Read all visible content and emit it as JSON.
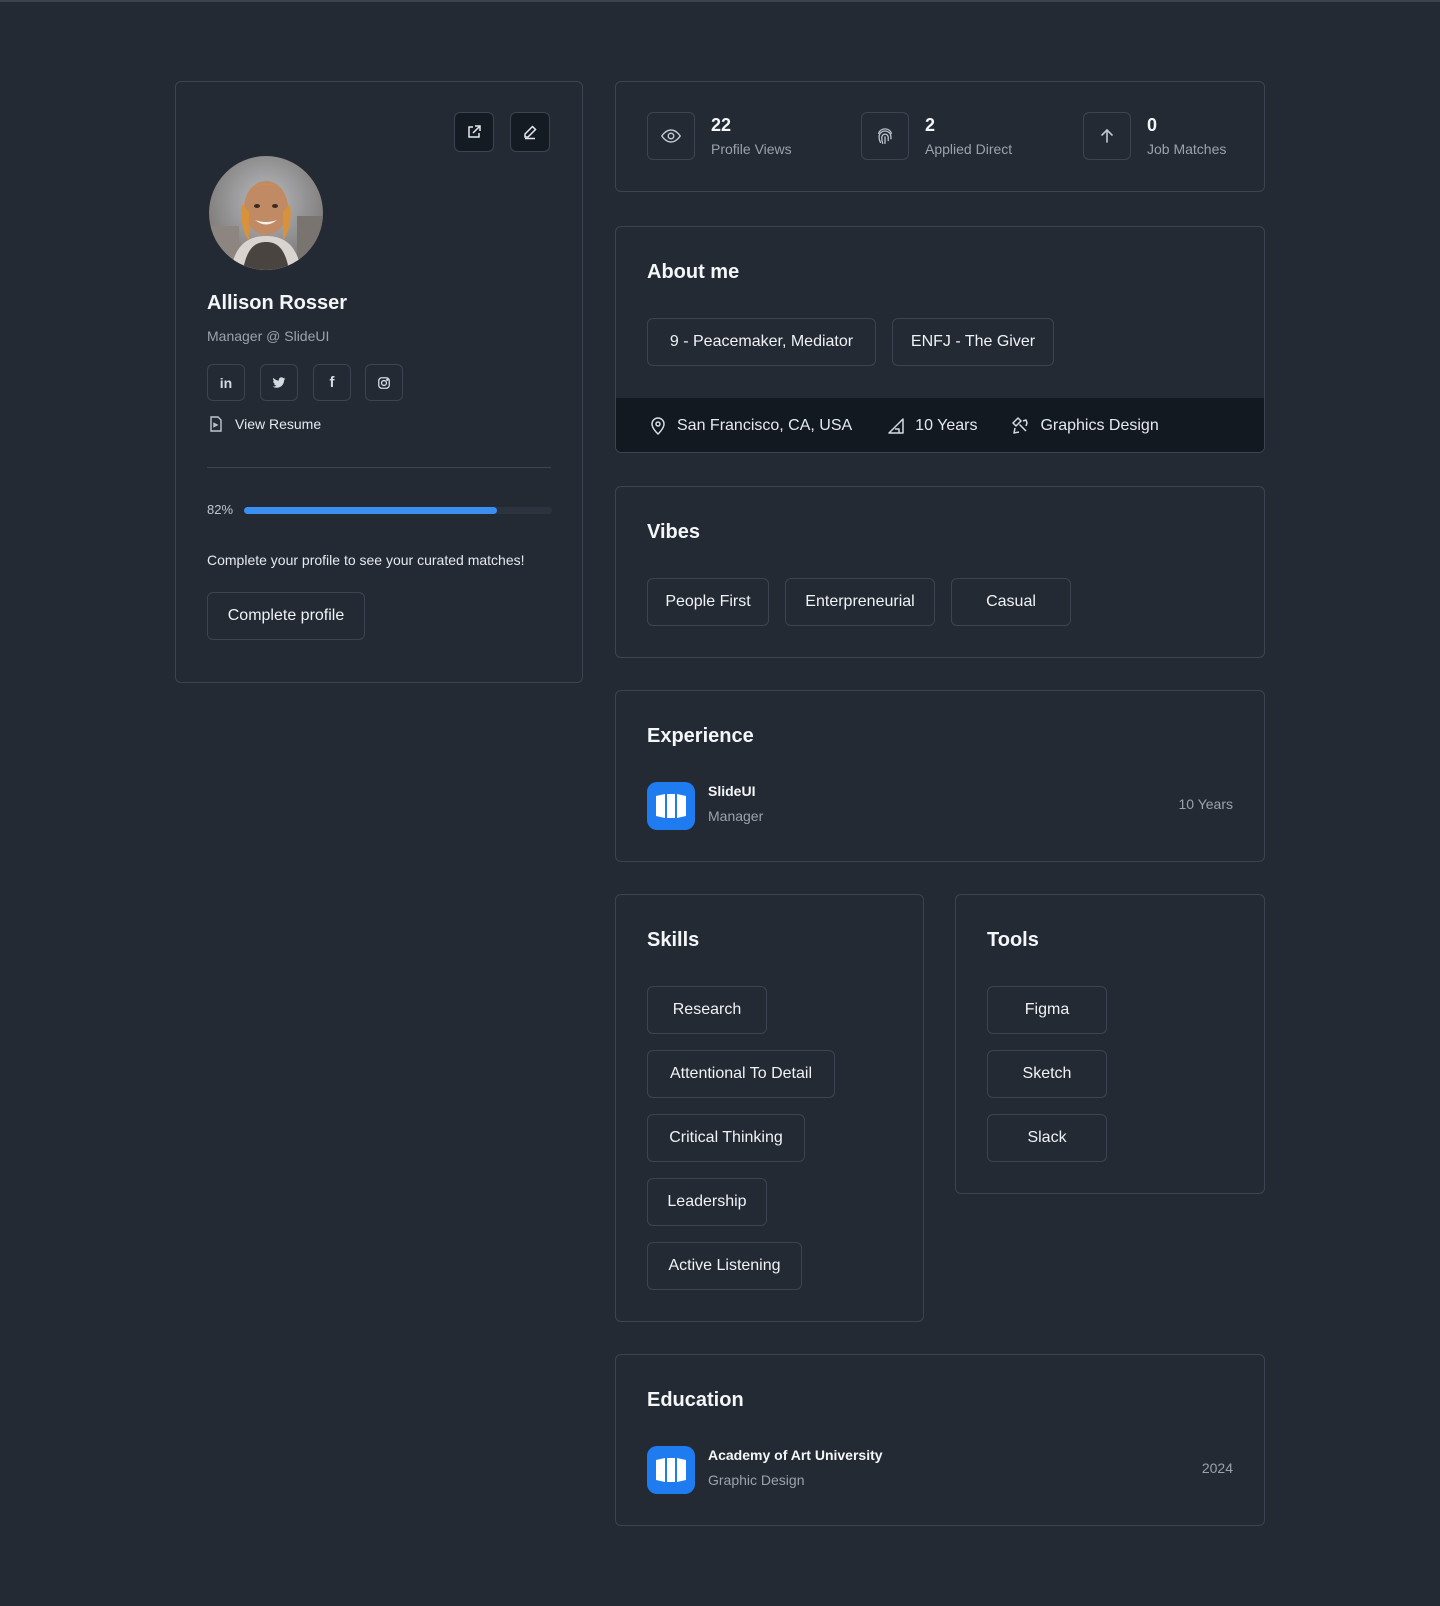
{
  "profile": {
    "name": "Allison Rosser",
    "role": "Manager @ SlideUI",
    "view_resume": "View Resume",
    "progress_label": "82%",
    "progress_value": 0.82,
    "complete_text": "Complete your profile to see your curated matches!",
    "complete_button": "Complete profile",
    "social": [
      {
        "icon": "linkedin-icon",
        "glyph": "in"
      },
      {
        "icon": "twitter-icon",
        "glyph": "twitter"
      },
      {
        "icon": "facebook-icon",
        "glyph": "f"
      },
      {
        "icon": "instagram-icon",
        "glyph": "instagram"
      }
    ]
  },
  "stats": [
    {
      "value": "22",
      "label": "Profile Views",
      "icon": "eye-icon"
    },
    {
      "value": "2",
      "label": "Applied Direct",
      "icon": "fingerprint-icon"
    },
    {
      "value": "0",
      "label": "Job Matches",
      "icon": "arrow-up-icon"
    }
  ],
  "about": {
    "title": "About me",
    "chips": [
      "9 - Peacemaker, Mediator",
      "ENFJ - The Giver"
    ],
    "location": "San Francisco, CA, USA",
    "experience_years": "10 Years",
    "field": "Graphics Design"
  },
  "vibes": {
    "title": "Vibes",
    "chips": [
      "People First",
      "Enterpreneurial",
      "Casual"
    ]
  },
  "experience": {
    "title": "Experience",
    "company": "SlideUI",
    "position": "Manager",
    "duration": "10 Years"
  },
  "skills": {
    "title": "Skills",
    "items": [
      "Research",
      "Attentional To Detail",
      "Critical Thinking",
      "Leadership",
      "Active Listening"
    ]
  },
  "tools": {
    "title": "Tools",
    "items": [
      "Figma",
      "Sketch",
      "Slack"
    ]
  },
  "education": {
    "title": "Education",
    "school": "Academy of Art University",
    "program": "Graphic Design",
    "year": "2024"
  },
  "colors": {
    "background": "#232a33",
    "card_border": "#3b4450",
    "accent": "#3b8ff0",
    "logo_blue": "#1f7cf0",
    "about_footer": "#131921"
  }
}
